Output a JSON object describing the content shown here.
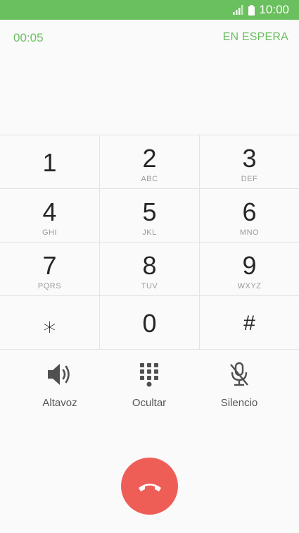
{
  "status_bar": {
    "time": "10:00"
  },
  "call": {
    "timer": "00:05",
    "hold_label": "EN ESPERA"
  },
  "keypad": {
    "rows": [
      [
        {
          "digit": "1",
          "letters": ""
        },
        {
          "digit": "2",
          "letters": "ABC"
        },
        {
          "digit": "3",
          "letters": "DEF"
        }
      ],
      [
        {
          "digit": "4",
          "letters": "GHI"
        },
        {
          "digit": "5",
          "letters": "JKL"
        },
        {
          "digit": "6",
          "letters": "MNO"
        }
      ],
      [
        {
          "digit": "7",
          "letters": "PQRS"
        },
        {
          "digit": "8",
          "letters": "TUV"
        },
        {
          "digit": "9",
          "letters": "WXYZ"
        }
      ],
      [
        {
          "digit": "⁎",
          "letters": ""
        },
        {
          "digit": "0",
          "letters": ""
        },
        {
          "digit": "#",
          "letters": ""
        }
      ]
    ]
  },
  "actions": {
    "speaker": {
      "label": "Altavoz",
      "icon": "speaker-icon"
    },
    "hide_keypad": {
      "label": "Ocultar",
      "icon": "dialpad-icon"
    },
    "mute": {
      "label": "Silencio",
      "icon": "mic-off-icon"
    }
  },
  "end_call": {
    "icon": "phone-hangup-icon",
    "color": "#ee5e57"
  },
  "colors": {
    "accent": "#6abf5e",
    "end_call": "#ee5e57"
  }
}
